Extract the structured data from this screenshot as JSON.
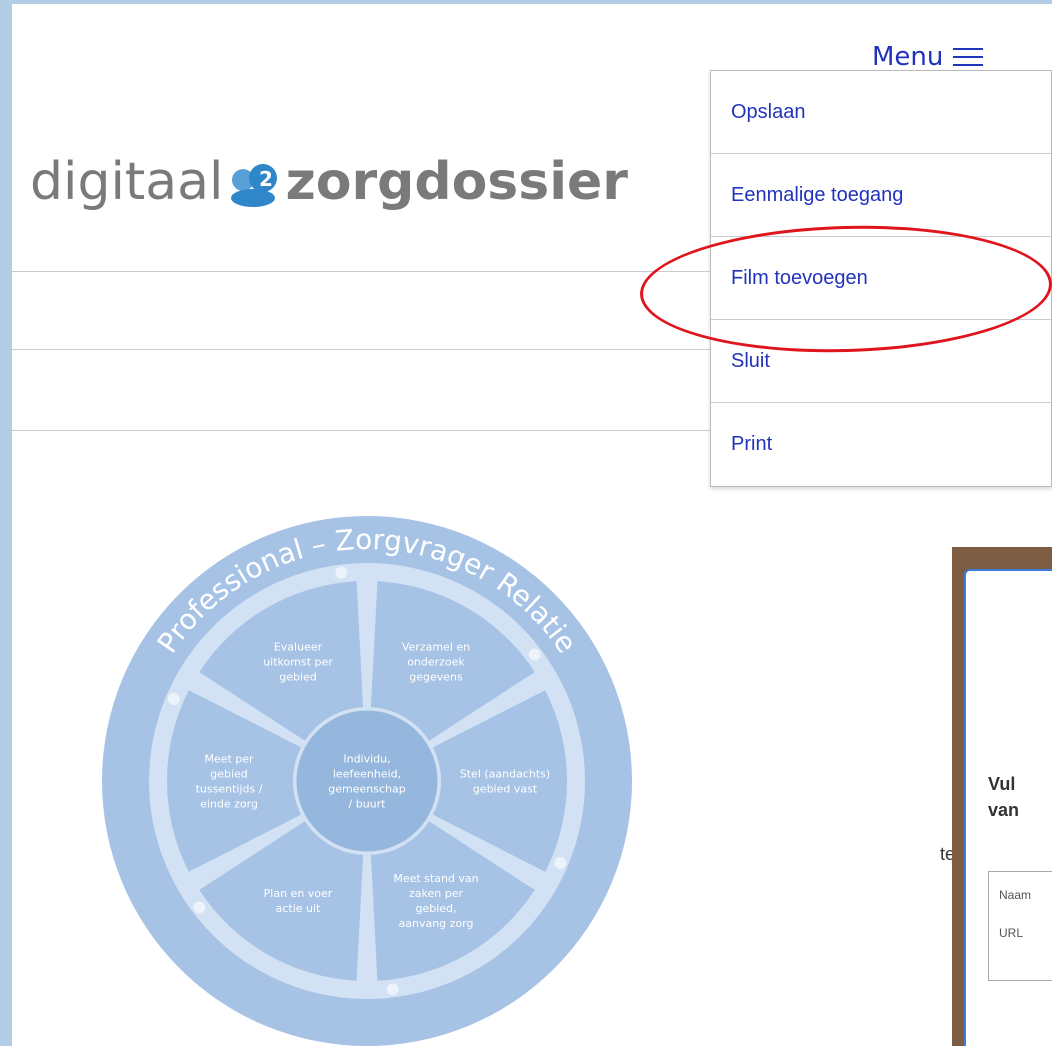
{
  "header": {
    "menu_label": "Menu",
    "logo_text_light": "digitaal",
    "logo_text_bold": "zorgdossier"
  },
  "menu": {
    "items": [
      {
        "label": "Opslaan"
      },
      {
        "label": "Eenmalige toegang"
      },
      {
        "label": "Film toevoegen"
      },
      {
        "label": "Sluit"
      },
      {
        "label": "Print"
      }
    ]
  },
  "diagram": {
    "ring_label": "Professional – Zorgvrager Relatie",
    "center": [
      "Individu,",
      "leefeenheid,",
      "gemeenschap",
      "/ buurt"
    ],
    "segments": [
      {
        "lines": [
          "Verzamel en",
          "onderzoek",
          "gegevens"
        ]
      },
      {
        "lines": [
          "Stel (aandachts)",
          "gebied vast"
        ]
      },
      {
        "lines": [
          "Meet stand van",
          "zaken per",
          "gebied,",
          "aanvang zorg"
        ]
      },
      {
        "lines": [
          "Plan en voer",
          "actie uit"
        ]
      },
      {
        "lines": [
          "Meet per",
          "gebied",
          "tussentijds /",
          "einde zorg"
        ]
      },
      {
        "lines": [
          "Evalueer",
          "uitkomst per",
          "gebied"
        ]
      }
    ],
    "colors": {
      "outer": "#a6c3e6",
      "segment": "#a6c3e6",
      "inner_track": "#d2e1f3",
      "center": "#96b7dd",
      "text": "#ffffff",
      "ring_text": "#ffffff"
    }
  },
  "modal": {
    "text_line1": "Vul",
    "text_line2": "van",
    "field_name_label": "Naam",
    "field_url_label": "URL"
  },
  "behind": {
    "partial_text": "te"
  },
  "colors": {
    "page_bg": "#b4cde6",
    "link": "#2233bb",
    "annotation": "#e0141c",
    "modal_border": "#3b7dd8"
  }
}
